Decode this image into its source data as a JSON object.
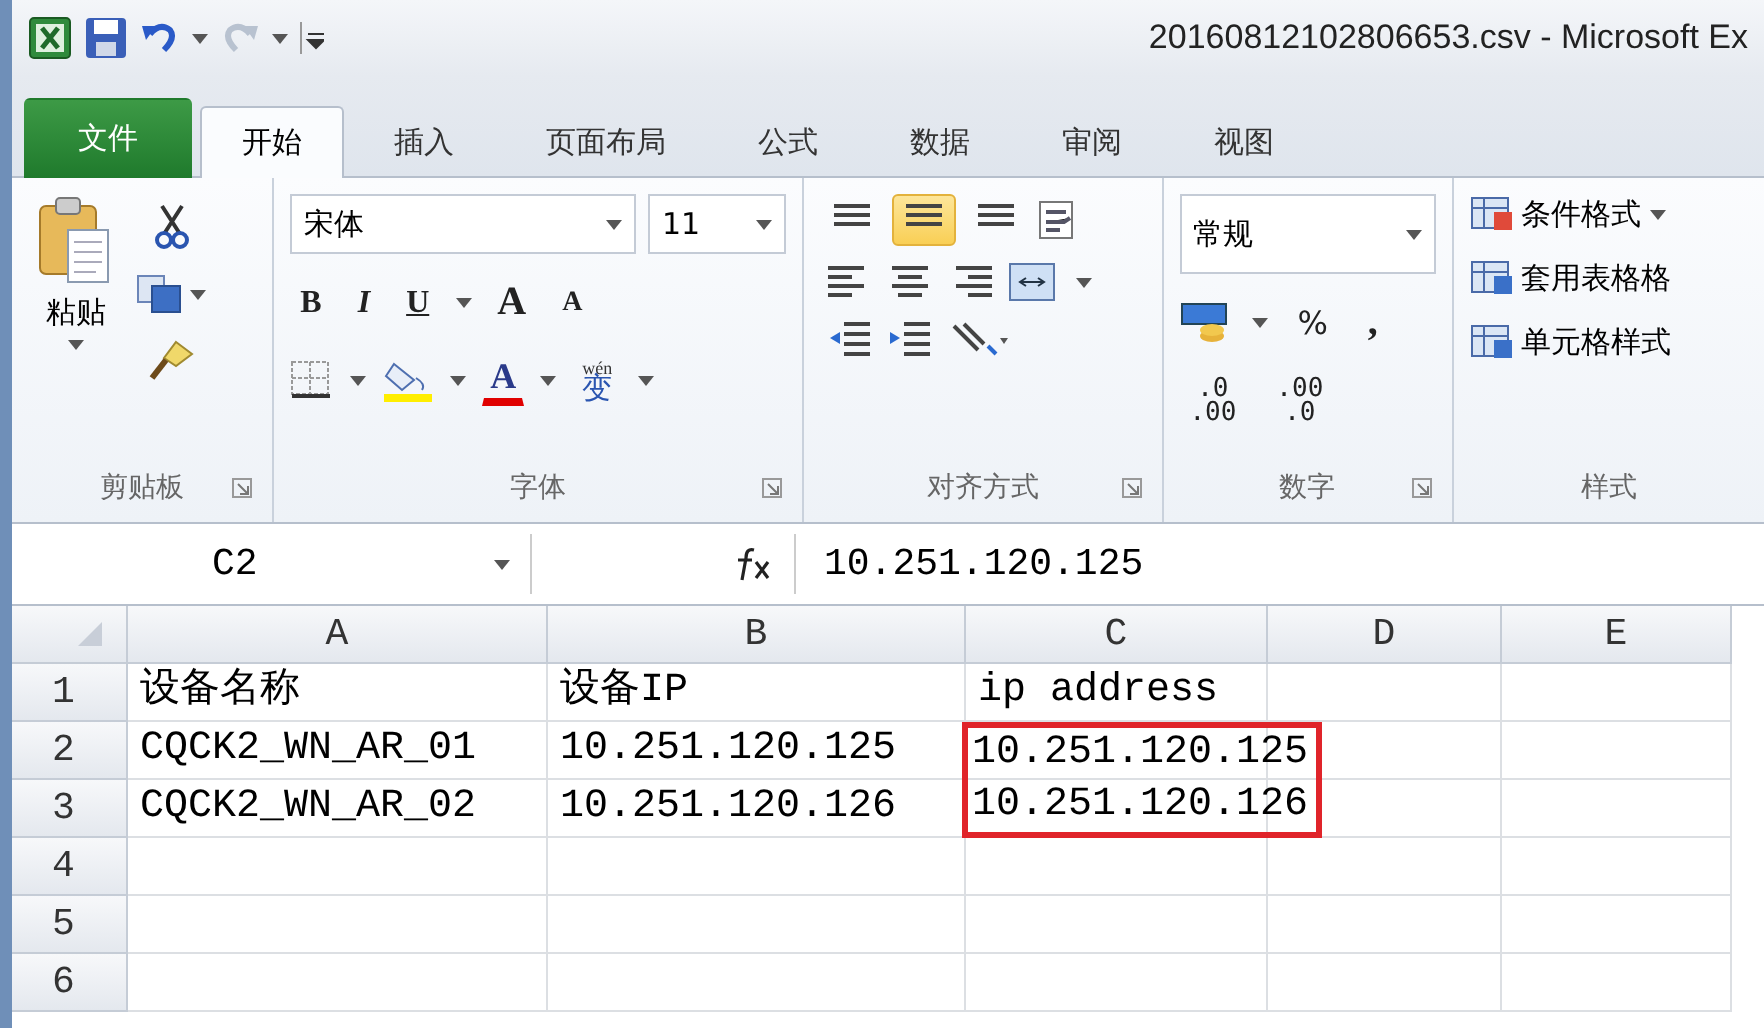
{
  "window": {
    "title": "20160812102806653.csv - Microsoft Ex"
  },
  "tabs": [
    {
      "label": "文件",
      "kind": "file",
      "selected": false
    },
    {
      "label": "开始",
      "kind": "tab",
      "selected": true
    },
    {
      "label": "插入",
      "kind": "tab",
      "selected": false
    },
    {
      "label": "页面布局",
      "kind": "tab",
      "selected": false
    },
    {
      "label": "公式",
      "kind": "tab",
      "selected": false
    },
    {
      "label": "数据",
      "kind": "tab",
      "selected": false
    },
    {
      "label": "审阅",
      "kind": "tab",
      "selected": false
    },
    {
      "label": "视图",
      "kind": "tab",
      "selected": false
    }
  ],
  "ribbon": {
    "clipboard": {
      "label": "剪贴板",
      "paste": "粘贴"
    },
    "font": {
      "label": "字体",
      "font_name": "宋体",
      "font_size": "11",
      "styles": [
        "B",
        "I",
        "U"
      ],
      "grow": "A",
      "shrink": "A",
      "font_color": "A",
      "phonetic_top": "wén",
      "phonetic_bottom": "变"
    },
    "alignment": {
      "label": "对齐方式",
      "vertical": [
        {
          "selected": false
        },
        {
          "selected": true
        },
        {
          "selected": false
        }
      ]
    },
    "number": {
      "label": "数字",
      "format": "常规",
      "percent": "%",
      "comma": ",",
      "increase_decimal": [
        ".0",
        ".00"
      ],
      "decrease_decimal": [
        ".00",
        ".0"
      ]
    },
    "styles": {
      "label": "样式",
      "items": [
        "条件格式",
        "套用表格格",
        "单元格样式"
      ]
    }
  },
  "formula_bar": {
    "name_box": "C2",
    "value": "10.251.120.125"
  },
  "sheet": {
    "columns": [
      "A",
      "B",
      "C",
      "D",
      "E"
    ],
    "rows": [
      {
        "number": "1",
        "cells": [
          {
            "text": "设备名称",
            "highlighted": false
          },
          {
            "text": "设备IP",
            "highlighted": false
          },
          {
            "text": "ip address",
            "highlighted": false
          },
          null,
          null
        ]
      },
      {
        "number": "2",
        "cells": [
          {
            "text": "CQCK2_WN_AR_01",
            "highlighted": false
          },
          {
            "text": "10.251.120.125",
            "highlighted": false
          },
          {
            "text": "10.251.120.125",
            "highlighted": true
          },
          null,
          null
        ]
      },
      {
        "number": "3",
        "cells": [
          {
            "text": "CQCK2_WN_AR_02",
            "highlighted": false
          },
          {
            "text": "10.251.120.126",
            "highlighted": false
          },
          {
            "text": "10.251.120.126",
            "highlighted": true
          },
          null,
          null
        ]
      },
      {
        "number": "4"
      },
      {
        "number": "5"
      },
      {
        "number": "6"
      }
    ]
  }
}
